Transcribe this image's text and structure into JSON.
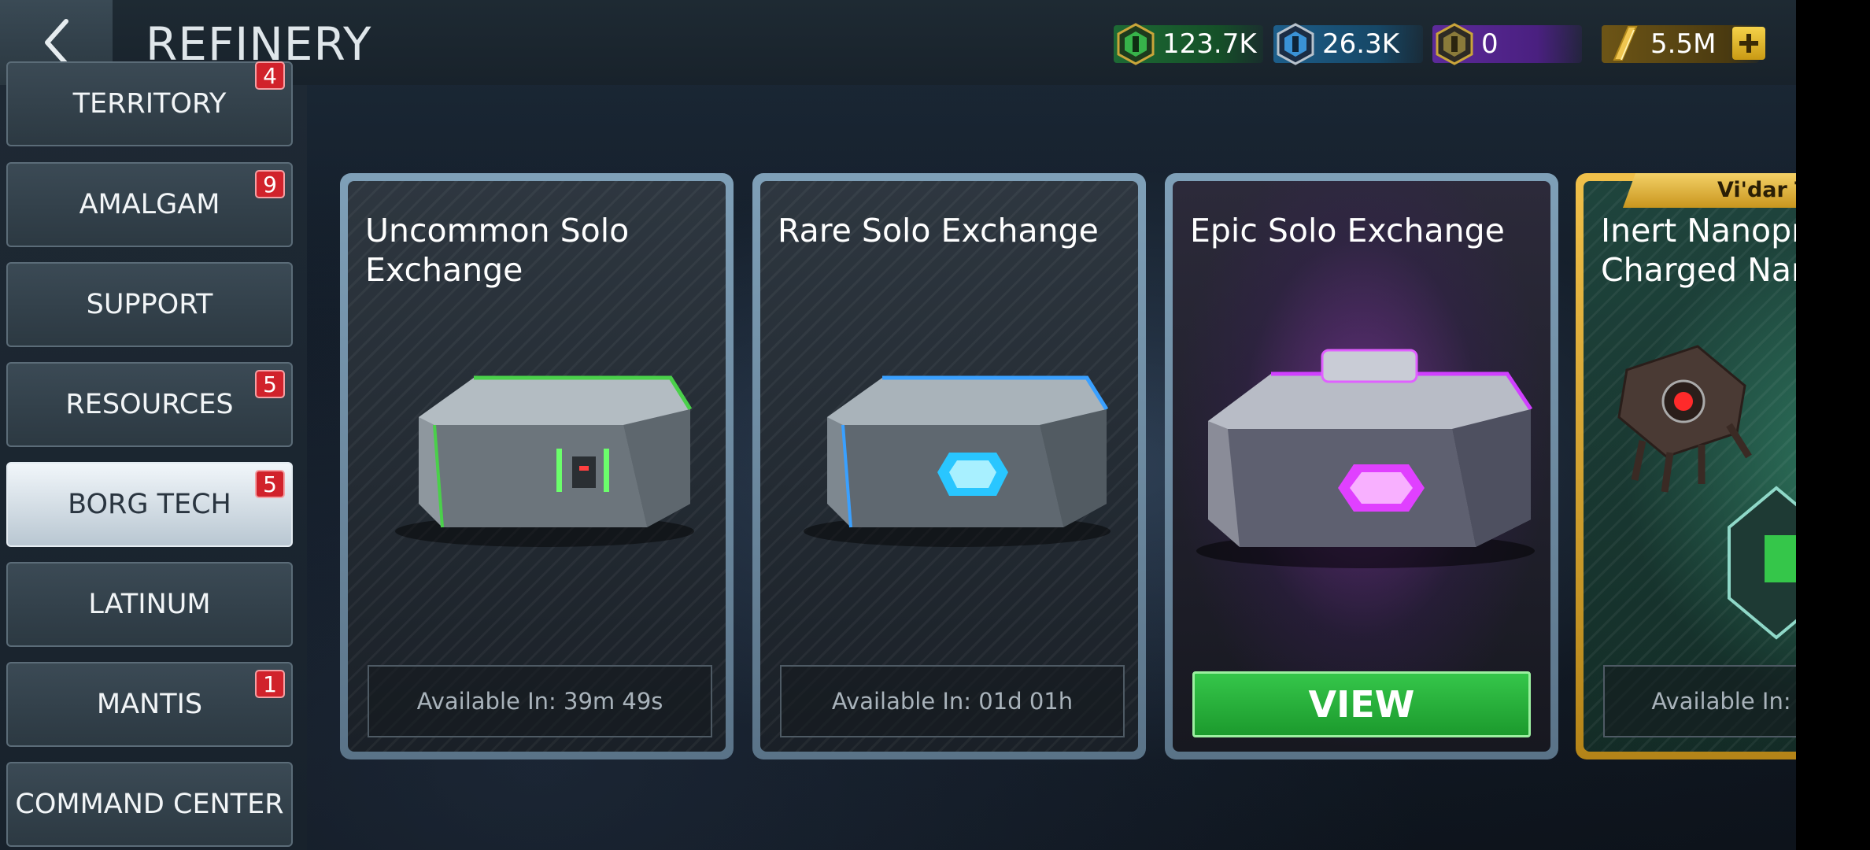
{
  "header": {
    "title": "REFINERY"
  },
  "resources": [
    {
      "name": "resource-green",
      "value": "123.7K",
      "icon": "green-hexagon-icon",
      "color": "#1f7a3a"
    },
    {
      "name": "resource-blue",
      "value": "26.3K",
      "icon": "blue-hexagon-icon",
      "color": "#1f6aa0"
    },
    {
      "name": "resource-purple",
      "value": "0",
      "icon": "purple-hexagon-icon",
      "color": "#6a2fb0"
    },
    {
      "name": "latinum",
      "value": "5.5M",
      "icon": "latinum-bar-icon",
      "color": "#9a7a1c"
    }
  ],
  "sidebar": {
    "items": [
      {
        "label": "TERRITORY",
        "badge": "4"
      },
      {
        "label": "AMALGAM",
        "badge": "9"
      },
      {
        "label": "SUPPORT",
        "badge": ""
      },
      {
        "label": "RESOURCES",
        "badge": "5"
      },
      {
        "label": "BORG TECH",
        "badge": "5",
        "active": true
      },
      {
        "label": "LATINUM",
        "badge": ""
      },
      {
        "label": "MANTIS",
        "badge": "1"
      },
      {
        "label": "COMMAND CENTER",
        "badge": ""
      }
    ]
  },
  "cards": [
    {
      "title": "Uncommon Solo Exchange",
      "status": "Available In: 39m 49s",
      "accent": "#4ad04a"
    },
    {
      "title": "Rare Solo Exchange",
      "status": "Available In: 01d 01h",
      "accent": "#3aa0ff"
    },
    {
      "title": "Epic Solo Exchange",
      "button": "VIEW",
      "accent": "#d040ff"
    },
    {
      "title": "Inert Nanopr Charged Nar",
      "status": "Available In:",
      "ribbon": "Vi'dar Ti",
      "accent": "#e0b030"
    }
  ]
}
